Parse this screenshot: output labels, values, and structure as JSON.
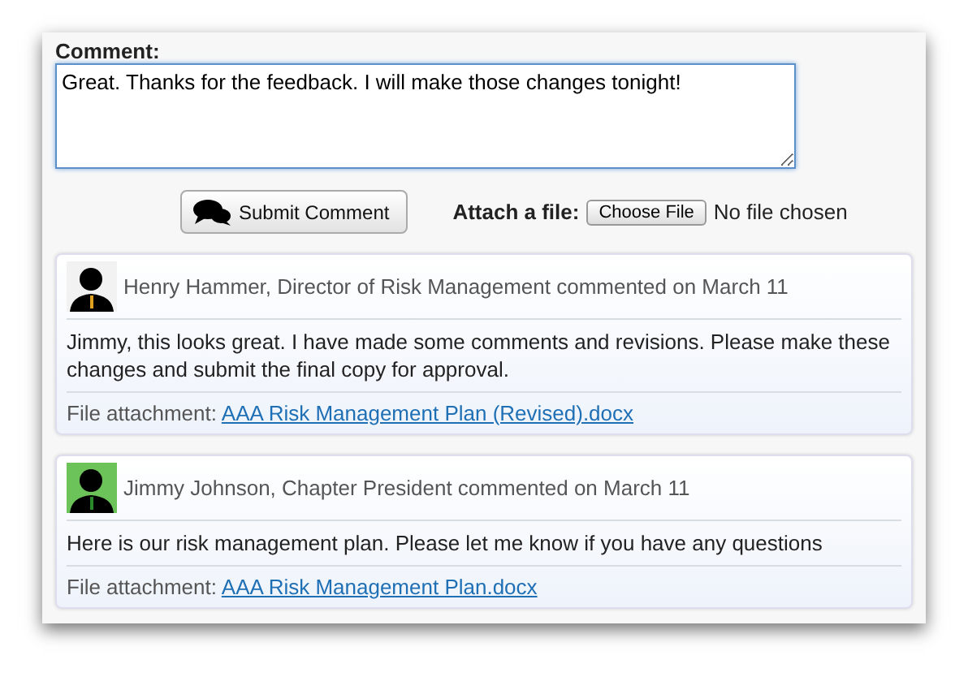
{
  "form": {
    "label": "Comment:",
    "comment": "Great. Thanks for the feedback. I will make those changes tonight!",
    "submit": "Submit Comment",
    "attach_label": "Attach a file:",
    "choose_button": "Choose File",
    "file_status": "No file chosen"
  },
  "comments": [
    {
      "author": "Henry Hammer, Director of Risk Management commented on March 11",
      "color": "#f2f2f2",
      "body": "Jimmy, this looks great. I have made some comments and revisions. Please make these changes and submit the final copy for approval.",
      "attachment_label": "File attachment:",
      "attachment": "AAA Risk Management Plan (Revised).docx"
    },
    {
      "author": "Jimmy Johnson, Chapter President commented on March 11",
      "color": "#6cc35a",
      "body": "Here is our risk management plan. Please let me know if you have any questions",
      "attachment_label": "File attachment:",
      "attachment": "AAA Risk Management Plan.docx"
    }
  ]
}
